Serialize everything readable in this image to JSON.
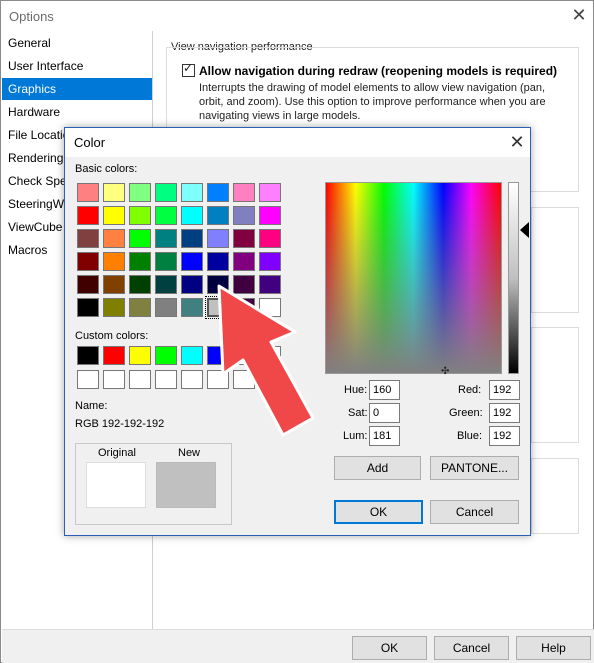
{
  "options": {
    "title": "Options",
    "sidebar": [
      {
        "label": "General",
        "selected": false
      },
      {
        "label": "User Interface",
        "selected": false
      },
      {
        "label": "Graphics",
        "selected": true
      },
      {
        "label": "Hardware",
        "selected": false
      },
      {
        "label": "File Locations",
        "selected": false
      },
      {
        "label": "Rendering",
        "selected": false
      },
      {
        "label": "Check Spelling",
        "selected": false
      },
      {
        "label": "SteeringWheels",
        "selected": false
      },
      {
        "label": "ViewCube",
        "selected": false
      },
      {
        "label": "Macros",
        "selected": false
      }
    ],
    "section_title": "View navigation performance",
    "checkbox_label": "Allow navigation during redraw (reopening models is required)",
    "checkbox_checked": true,
    "checkbox_description": "Interrupts the drawing of model elements to allow view navigation (pan, orbit, and zoom). Use this option to improve performance when you are navigating views in large models.",
    "buttons": {
      "ok": "OK",
      "cancel": "Cancel",
      "help": "Help"
    }
  },
  "color_dialog": {
    "title": "Color",
    "basic_colors_label": "Basic colors:",
    "basic_colors": [
      "#ff8080",
      "#ffff80",
      "#80ff80",
      "#00ff80",
      "#80ffff",
      "#0080ff",
      "#ff80c0",
      "#ff80ff",
      "#ff0000",
      "#ffff00",
      "#80ff00",
      "#00ff40",
      "#00ffff",
      "#0080c0",
      "#8080c0",
      "#ff00ff",
      "#804040",
      "#ff8040",
      "#00ff00",
      "#008080",
      "#004080",
      "#8080ff",
      "#800040",
      "#ff0080",
      "#800000",
      "#ff8000",
      "#008000",
      "#008040",
      "#0000ff",
      "#0000a0",
      "#800080",
      "#8000ff",
      "#400000",
      "#804000",
      "#004000",
      "#004040",
      "#000080",
      "#000040",
      "#400040",
      "#400080",
      "#000000",
      "#808000",
      "#808040",
      "#808080",
      "#408080",
      "#c0c0c0",
      "#400040",
      "#ffffff"
    ],
    "selected_basic_index": 45,
    "custom_colors_label": "Custom colors:",
    "custom_colors": [
      "#000000",
      "#ff0000",
      "#ffff00",
      "#00ff00",
      "#00ffff",
      "#0000ff",
      "#ffffff",
      "#ffffff",
      "#ffffff",
      "#ffffff",
      "#ffffff",
      "#ffffff",
      "#ffffff",
      "#ffffff",
      "#ffffff",
      "#ffffff"
    ],
    "name_label": "Name:",
    "name_value": "RGB 192-192-192",
    "original_label": "Original",
    "new_label": "New",
    "original_color": "#ffffff",
    "new_color": "#c0c0c0",
    "fields": {
      "hue_label": "Hue:",
      "hue": "160",
      "sat_label": "Sat:",
      "sat": "0",
      "lum_label": "Lum:",
      "lum": "181",
      "red_label": "Red:",
      "red": "192",
      "green_label": "Green:",
      "green": "192",
      "blue_label": "Blue:",
      "blue": "192"
    },
    "add_label": "Add",
    "pantone_label": "PANTONE...",
    "ok_label": "OK",
    "cancel_label": "Cancel"
  },
  "colors": {
    "accent": "#0078d7",
    "arrow": "#f04848"
  }
}
